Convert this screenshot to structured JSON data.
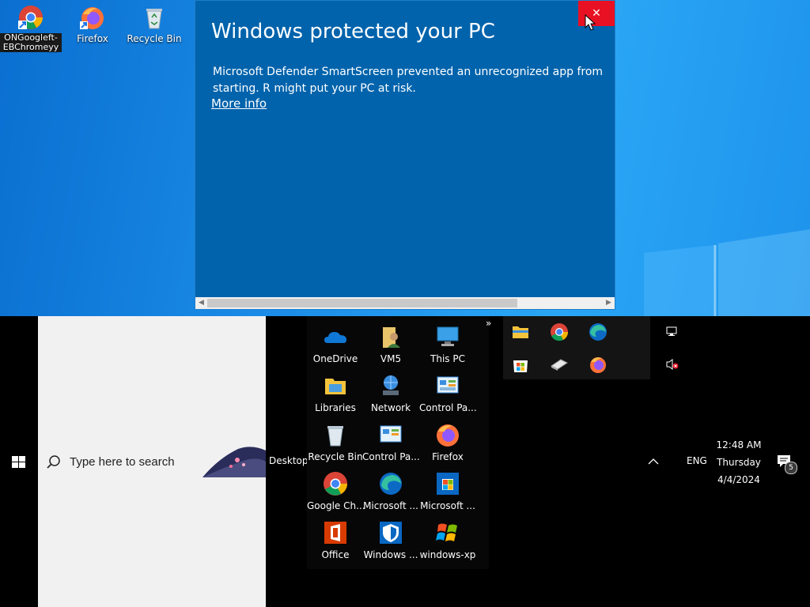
{
  "desktop": {
    "icons": [
      {
        "label": "ONGoogleft-\nEBChromeyy",
        "icon": "chrome-icon"
      },
      {
        "label": "Firefox",
        "icon": "firefox-icon"
      },
      {
        "label": "Recycle Bin",
        "icon": "recycle-bin-icon"
      }
    ]
  },
  "dialog": {
    "title": "Windows protected your PC",
    "body": "Microsoft Defender SmartScreen prevented an unrecognized app from starting. R might put your PC at risk.",
    "more_info": "More info",
    "close_glyph": "✕"
  },
  "taskbar": {
    "search_placeholder": "Type here to search",
    "desktop_toolbar_label": "Desktop",
    "toolbar_overflow": "»",
    "tray": {
      "language": "ENG",
      "time": "12:48 AM",
      "day": "Thursday",
      "date": "4/4/2024",
      "notification_count": "5"
    }
  },
  "flyout": {
    "items": [
      {
        "label": "OneDrive",
        "icon": "onedrive-icon"
      },
      {
        "label": "VM5",
        "icon": "user-folder-icon"
      },
      {
        "label": "This PC",
        "icon": "this-pc-icon"
      },
      {
        "label": "Libraries",
        "icon": "libraries-icon"
      },
      {
        "label": "Network",
        "icon": "network-icon"
      },
      {
        "label": "Control Pa...",
        "icon": "control-panel-icon"
      },
      {
        "label": "Recycle Bin",
        "icon": "recycle-bin-icon"
      },
      {
        "label": "Control Pa...",
        "icon": "control-panel-icon"
      },
      {
        "label": "Firefox",
        "icon": "firefox-icon"
      },
      {
        "label": "Google Ch...",
        "icon": "chrome-icon"
      },
      {
        "label": "Microsoft ...",
        "icon": "edge-icon"
      },
      {
        "label": "Microsoft ...",
        "icon": "store-icon"
      },
      {
        "label": "Office",
        "icon": "office-icon"
      },
      {
        "label": "Windows ...",
        "icon": "windows-security-icon"
      },
      {
        "label": "windows-xp",
        "icon": "windows-xp-icon"
      }
    ]
  },
  "colors": {
    "dialog_bg": "#0063ac",
    "close_red": "#e81123",
    "desktop_blue": "#1a8ae6"
  }
}
